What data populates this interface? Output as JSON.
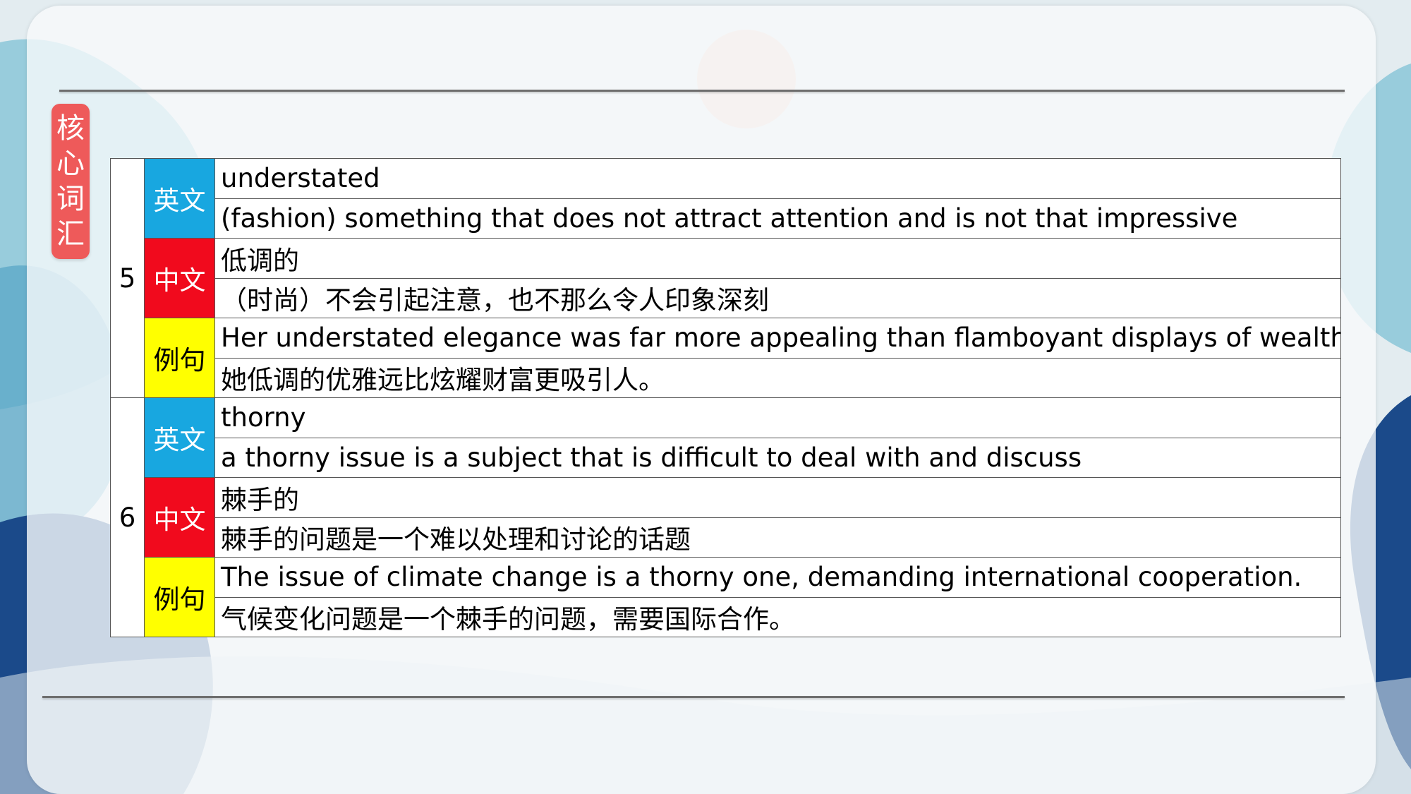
{
  "side_tag": [
    "核",
    "心",
    "词",
    "汇"
  ],
  "entries": [
    {
      "number": "5",
      "english_label": "英文",
      "chinese_label": "中文",
      "example_label": "例句",
      "word": "understated",
      "definition": "(fashion) something that does not attract attention and is not that impressive",
      "zh_word": "低调的",
      "zh_definition": "（时尚）不会引起注意，也不那么令人印象深刻",
      "example_en": "Her understated elegance was far more appealing than flamboyant displays of wealth.",
      "example_zh": "她低调的优雅远比炫耀财富更吸引人。"
    },
    {
      "number": "6",
      "english_label": "英文",
      "chinese_label": "中文",
      "example_label": "例句",
      "word": "thorny",
      "definition": "a thorny issue is a subject that is difficult to deal with and discuss",
      "zh_word": "棘手的",
      "zh_definition": "棘手的问题是一个难以处理和讨论的话题",
      "example_en": "The issue of climate change is a thorny one, demanding international cooperation.",
      "example_zh": "气候变化问题是一个棘手的问题，需要国际合作。"
    }
  ],
  "colors": {
    "english_label_bg": "#18a7e0",
    "chinese_label_bg": "#f10a1d",
    "example_label_bg": "#ffff00",
    "side_tag_bg": "#ee5a5a"
  }
}
